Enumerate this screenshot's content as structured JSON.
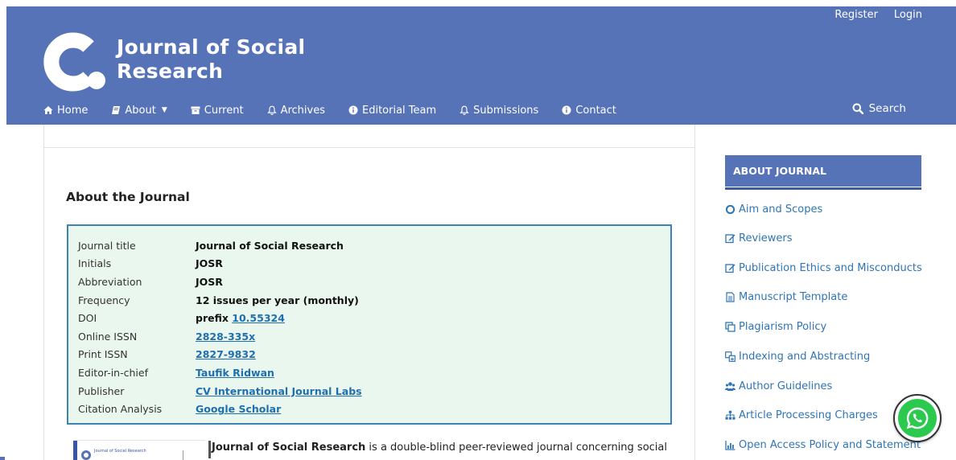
{
  "header": {
    "site_title_line1": "Journal of Social",
    "site_title_line2": "Research",
    "user_nav": [
      "Register",
      "Login"
    ],
    "nav": [
      {
        "label": "Home",
        "icon": "home-icon"
      },
      {
        "label": "About",
        "icon": "book-icon",
        "dropdown": true
      },
      {
        "label": "Current",
        "icon": "archive-box-icon"
      },
      {
        "label": "Archives",
        "icon": "bell-icon"
      },
      {
        "label": "Editorial Team",
        "icon": "info-circle-icon"
      },
      {
        "label": "Submissions",
        "icon": "bell-icon"
      },
      {
        "label": "Contact",
        "icon": "info-circle-icon"
      }
    ],
    "search_label": "Search",
    "brand_color": "#5673b8"
  },
  "main": {
    "page_title": "About the Journal",
    "info": [
      {
        "key": "Journal title",
        "value": "Journal of Social Research"
      },
      {
        "key": "Initials",
        "value": "JOSR"
      },
      {
        "key": "Abbreviation",
        "value": "JOSR"
      },
      {
        "key": "Frequency",
        "value": "12 issues per year (monthly)"
      },
      {
        "key": "DOI",
        "prefix": "prefix ",
        "link": "10.55324"
      },
      {
        "key": "Online ISSN",
        "link": "2828-335x"
      },
      {
        "key": "Print ISSN",
        "link": "2827-9832"
      },
      {
        "key": "Editor-in-chief",
        "link": "Taufik Ridwan"
      },
      {
        "key": "Publisher",
        "link": "CV International Journal Labs"
      },
      {
        "key": "Citation Analysis",
        "link": "Google Scholar "
      }
    ],
    "cover_text": "Journal of Social Research",
    "intro_bold": "Journal of Social Research",
    "intro_rest": " is a double-blind peer-reviewed journal concerning social",
    "info_box_bg": "#e9f7ee",
    "info_box_border": "#3a83b3"
  },
  "sidebar": {
    "heading": "ABOUT JOURNAL",
    "items": [
      {
        "label": "Aim and Scopes",
        "icon": "circle-outline-icon"
      },
      {
        "label": "Reviewers",
        "icon": "edit-icon"
      },
      {
        "label": "Publication Ethics and Misconducts",
        "icon": "edit-icon"
      },
      {
        "label": "Manuscript Template",
        "icon": "document-icon"
      },
      {
        "label": "Plagiarism Policy",
        "icon": "copy-icon"
      },
      {
        "label": " Indexing and Abstracting",
        "icon": "translate-icon"
      },
      {
        "label": "Author Guidelines",
        "icon": "users-icon"
      },
      {
        "label": "Article Processing Charges",
        "icon": "sitemap-icon"
      },
      {
        "label": "Open Access Policy and Statement",
        "icon": "bar-chart-icon"
      }
    ],
    "link_color": "#2f75b5"
  },
  "floating": {
    "whatsapp_icon": "whatsapp-icon",
    "color": "#2cc94f"
  }
}
